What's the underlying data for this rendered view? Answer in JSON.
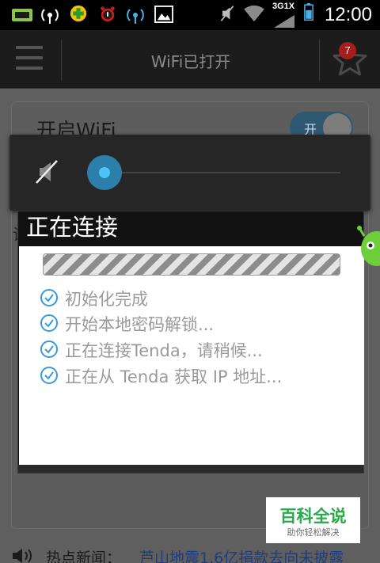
{
  "status_bar": {
    "time": "12:00",
    "network_label": "3G1X",
    "icons": [
      "usb-debug-icon",
      "wifi-signal-icon",
      "plus-app-icon",
      "alarm-icon",
      "wifi-signal-icon",
      "image-icon",
      "mute-icon",
      "wifi-icon",
      "signal-bars-icon",
      "battery-icon"
    ]
  },
  "header": {
    "title": "WiFi已打开",
    "favorites_badge": "7"
  },
  "main": {
    "wifi_label": "开启WiFi",
    "wifi_toggle_label": "开",
    "side_char": "设"
  },
  "volume": {
    "level": 0
  },
  "dialog": {
    "title": "正在连接",
    "steps": [
      "初始化完成",
      "开始本地密码解锁...",
      "正在连接Tenda，请稍候...",
      "正在从 Tenda 获取 IP 地址..."
    ]
  },
  "news": {
    "prefix": "热点新闻：",
    "headline": "芦山地震1.6亿捐款去向未披露"
  },
  "watermark": {
    "title": "百科全说",
    "subtitle": "助你轻松解决"
  },
  "colors": {
    "accent": "#2c7eab",
    "check": "#3a9ad9",
    "badge": "#a51d1d",
    "watermark_green": "#2aa84a"
  }
}
